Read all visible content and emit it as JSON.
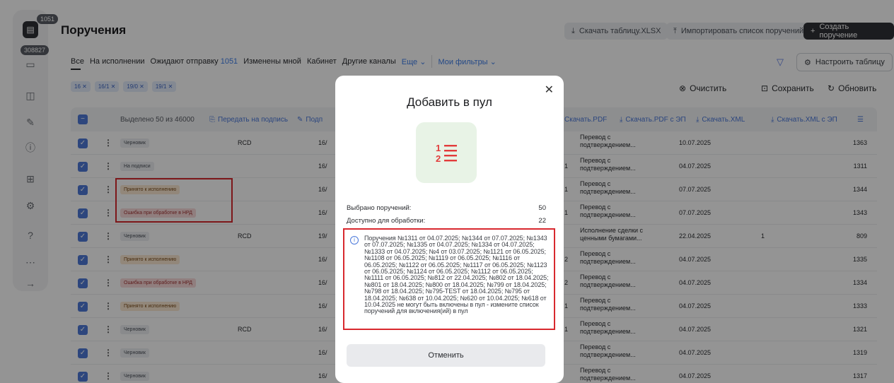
{
  "rail": {
    "badge_top": "1051",
    "badge_second": "308827",
    "icons": [
      "document-icon",
      "archive-icon",
      "card-icon",
      "edit-icon",
      "info-icon",
      "grid-icon",
      "settings-icon",
      "help-icon",
      "more-icon",
      "arrow-right-icon"
    ]
  },
  "header": {
    "title": "Поручения",
    "download_xlsx": "Скачать таблицу.XLSX",
    "import": "Импортировать список поручений",
    "create": "Создать поручение"
  },
  "tabs": {
    "all": "Все",
    "in_progress": "На исполнении",
    "awaiting": "Ожидают отправку",
    "awaiting_count": "1051",
    "changed_by_me": "Изменены мной",
    "cabinet": "Кабинет",
    "other_channels": "Другие каналы",
    "more": "Еще",
    "my_filters": "Мои фильтры",
    "configure": "Настроить таблицу"
  },
  "chips": [
    "16 ✕",
    "16/1 ✕",
    "19/0 ✕",
    "19/1 ✕"
  ],
  "chip_actions": {
    "clear": "Очистить",
    "save": "Сохранить",
    "refresh": "Обновить"
  },
  "table_header": {
    "selected": "Выделено 50 из 46000",
    "send_to_sign": "Передать на подпись",
    "sign_cut": "Подп",
    "download_pdf": "Скачать.PDF",
    "download_pdf_ep": "Скачать.PDF с ЭП",
    "download_xml": "Скачать.XML",
    "download_xml_ep": "Скачать.XML с ЭП"
  },
  "rows": [
    {
      "status": "Черновик",
      "status_kind": "gray",
      "rcd": "RCD",
      "cut": "16/",
      "left": "",
      "type1": "Перевод с",
      "type2": "подтверждением...",
      "date": "10.07.2025",
      "one": "",
      "num": "1363"
    },
    {
      "status": "На подписи",
      "status_kind": "gray",
      "rcd": "",
      "cut": "16/",
      "left": "1",
      "type1": "Перевод с",
      "type2": "подтверждением...",
      "date": "04.07.2025",
      "one": "",
      "num": "1311"
    },
    {
      "status": "Принято к исполнению",
      "status_kind": "yellow",
      "rcd": "",
      "cut": "16/",
      "left": "1",
      "type1": "Перевод с",
      "type2": "подтверждением...",
      "date": "07.07.2025",
      "one": "",
      "num": "1344"
    },
    {
      "status": "Ошибка при обработке в НРД",
      "status_kind": "red",
      "rcd": "",
      "cut": "16/",
      "left": "1",
      "type1": "Перевод с",
      "type2": "подтверждением...",
      "date": "07.07.2025",
      "one": "",
      "num": "1343"
    },
    {
      "status": "Черновик",
      "status_kind": "gray",
      "rcd": "RCD",
      "cut": "19/",
      "left": "",
      "type1": "Исполнение сделки с",
      "type2": "ценными бумагами...",
      "date": "22.04.2025",
      "one": "1",
      "num": "809"
    },
    {
      "status": "Принято к исполнению",
      "status_kind": "yellow",
      "rcd": "",
      "cut": "16/",
      "left": "2",
      "type1": "Перевод с",
      "type2": "подтверждением...",
      "date": "04.07.2025",
      "one": "",
      "num": "1335"
    },
    {
      "status": "Ошибка при обработке в НРД",
      "status_kind": "red",
      "rcd": "",
      "cut": "16/",
      "left": "2",
      "type1": "Перевод с",
      "type2": "подтверждением...",
      "date": "04.07.2025",
      "one": "",
      "num": "1334"
    },
    {
      "status": "Принято к исполнению",
      "status_kind": "yellow",
      "rcd": "",
      "cut": "16/",
      "left": "1",
      "type1": "Перевод с",
      "type2": "подтверждением...",
      "date": "04.07.2025",
      "one": "",
      "num": "1333"
    },
    {
      "status": "Черновик",
      "status_kind": "gray",
      "rcd": "RCD",
      "cut": "16/",
      "left": "1",
      "type1": "Перевод с",
      "type2": "подтверждением...",
      "date": "04.07.2025",
      "one": "",
      "num": "1321"
    },
    {
      "status": "Черновик",
      "status_kind": "gray",
      "rcd": "",
      "cut": "16/",
      "left": "",
      "type1": "Перевод с",
      "type2": "подтверждением...",
      "date": "04.07.2025",
      "one": "",
      "num": "1319"
    },
    {
      "status": "Черновик",
      "status_kind": "gray",
      "rcd": "",
      "cut": "16/",
      "left": "",
      "type1": "Перевод с",
      "type2": "подтверждением...",
      "date": "04.07.2025",
      "one": "",
      "num": "1317"
    }
  ],
  "modal": {
    "title": "Добавить в пул",
    "selected_label": "Выбрано поручений:",
    "selected_value": "50",
    "available_label": "Доступно для обработки:",
    "available_value": "22",
    "warning": "Поручения №1311 от 04.07.2025; №1344 от 07.07.2025; №1343 от 07.07.2025; №1335 от 04.07.2025; №1334 от 04.07.2025; №1333 от 04.07.2025; №4 от 03.07.2025; №1121 от 06.05.2025; №1108 от 06.05.2025; №1119 от 06.05.2025; №1116 от 06.05.2025; №1122 от 06.05.2025; №1117 от 06.05.2025; №1123 от 06.05.2025; №1124 от 06.05.2025; №1112 от 06.05.2025; №1111 от 06.05.2025; №812 от 22.04.2025; №802 от 18.04.2025; №801 от 18.04.2025; №800 от 18.04.2025; №799 от 18.04.2025; №798 от 18.04.2025; №795-TEST от 18.04.2025; №795 от 18.04.2025; №638 от 10.04.2025; №620 от 10.04.2025; №618 от 10.04.2025 не могут быть включены в пул - измените список поручений для включения(ий) в пул",
    "cancel": "Отменить"
  }
}
